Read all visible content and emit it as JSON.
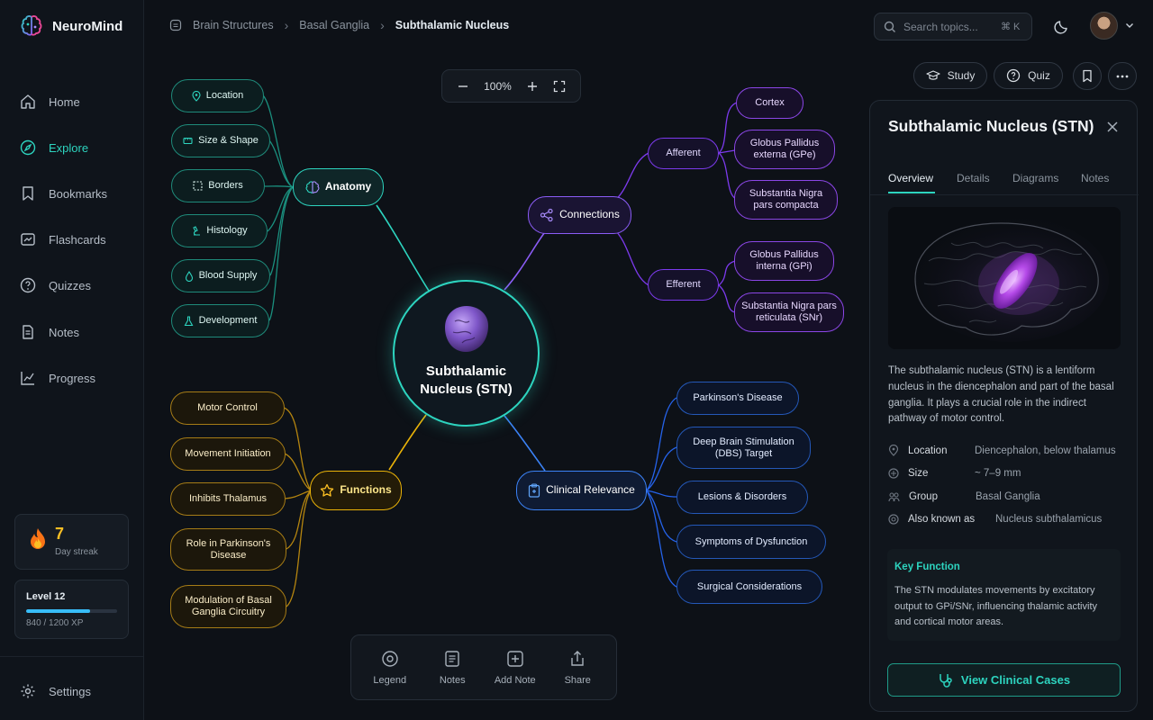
{
  "app": {
    "name": "NeuroMind"
  },
  "sidebar": {
    "items": [
      {
        "label": "Home",
        "icon": "home-icon"
      },
      {
        "label": "Explore",
        "icon": "compass-icon",
        "active": true
      },
      {
        "label": "Bookmarks",
        "icon": "bookmark-icon"
      },
      {
        "label": "Flashcards",
        "icon": "flashcards-icon"
      },
      {
        "label": "Quizzes",
        "icon": "question-icon"
      },
      {
        "label": "Notes",
        "icon": "notes-icon"
      },
      {
        "label": "Progress",
        "icon": "chart-icon"
      }
    ],
    "streak": {
      "count": "7",
      "label": "Day streak"
    },
    "level": {
      "title": "Level 12",
      "xp": "840 / 1200 XP",
      "progress": 0.7
    },
    "settings": "Settings"
  },
  "breadcrumb": [
    "Brain Structures",
    "Basal Ganglia",
    "Subthalamic Nucleus"
  ],
  "search": {
    "placeholder": "Search topics...",
    "shortcut": "⌘ K"
  },
  "actions": {
    "study": "Study",
    "quiz": "Quiz"
  },
  "zoom": {
    "level": "100%"
  },
  "mindmap": {
    "center": {
      "line1": "Subthalamic",
      "line2": "Nucleus (STN)"
    },
    "anatomy": {
      "label": "Anatomy",
      "children": [
        "Location",
        "Size & Shape",
        "Borders",
        "Histology",
        "Blood Supply",
        "Development"
      ]
    },
    "connections": {
      "label": "Connections",
      "afferent": {
        "label": "Afferent",
        "children": [
          "Cortex",
          "Globus Pallidus externa (GPe)",
          "Substantia Nigra pars compacta"
        ]
      },
      "efferent": {
        "label": "Efferent",
        "children": [
          "Globus Pallidus interna (GPi)",
          "Substantia Nigra pars reticulata (SNr)"
        ]
      }
    },
    "functions": {
      "label": "Functions",
      "children": [
        "Motor Control",
        "Movement Initiation",
        "Inhibits Thalamus",
        "Role in Parkinson's Disease",
        "Modulation of Basal Ganglia Circuitry"
      ]
    },
    "clinical": {
      "label": "Clinical Relevance",
      "children": [
        "Parkinson's Disease",
        "Deep Brain Stimulation (DBS) Target",
        "Lesions & Disorders",
        "Symptoms of Dysfunction",
        "Surgical Considerations"
      ]
    }
  },
  "toolbar": {
    "legend": "Legend",
    "notes": "Notes",
    "add_note": "Add Note",
    "share": "Share"
  },
  "panel": {
    "title": "Subthalamic Nucleus (STN)",
    "tabs": [
      "Overview",
      "Details",
      "Diagrams",
      "Notes"
    ],
    "description": "The subthalamic nucleus (STN) is a lentiform nucleus in the diencephalon and part of the basal ganglia. It plays a crucial role in the indirect pathway of motor control.",
    "properties": [
      {
        "key": "Location",
        "value": "Diencephalon, below thalamus",
        "icon": "pin-icon"
      },
      {
        "key": "Size",
        "value": "~ 7–9 mm",
        "icon": "ruler-icon"
      },
      {
        "key": "Group",
        "value": "Basal Ganglia",
        "icon": "group-icon"
      },
      {
        "key": "Also known as",
        "value": "Nucleus subthalamicus",
        "icon": "at-icon"
      }
    ],
    "key_function": {
      "title": "Key Function",
      "text": "The STN modulates movements by excitatory output to GPi/SNr, influencing thalamic activity and cortical motor areas."
    },
    "cta": "View Clinical Cases"
  },
  "colors": {
    "accent": "#2dd4bf",
    "purple": "#8b5cf6",
    "gold": "#eab308",
    "blue": "#3b82f6",
    "background": "#0d1117"
  }
}
